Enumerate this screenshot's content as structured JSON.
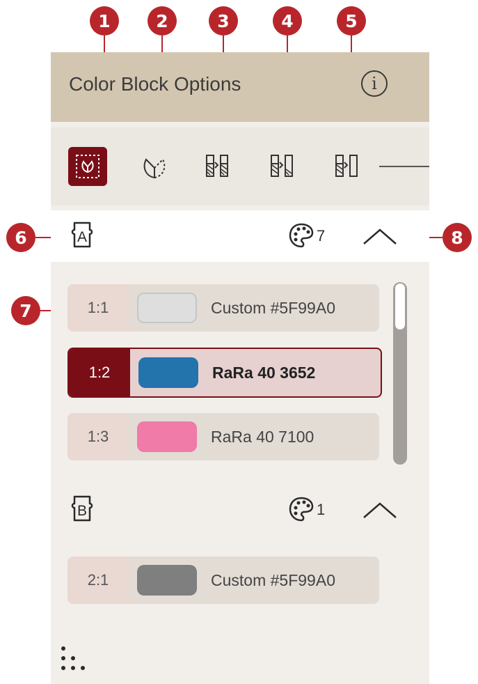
{
  "callouts": [
    "1",
    "2",
    "3",
    "4",
    "5",
    "6",
    "7",
    "8"
  ],
  "header": {
    "title": "Color Block Options",
    "info_icon": "info-icon",
    "info_glyph": "i"
  },
  "toolbar": {
    "buttons": [
      {
        "icon": "embroidery-select-icon",
        "active": true
      },
      {
        "icon": "design-outline-icon",
        "active": false
      },
      {
        "icon": "color-block-merge-icon",
        "active": false
      },
      {
        "icon": "color-block-merge-next-icon",
        "active": false
      },
      {
        "icon": "color-block-split-icon",
        "active": false
      }
    ]
  },
  "groups": [
    {
      "icon": "group-a-icon",
      "letter": "A",
      "palette_icon": "palette-icon",
      "color_count": "7",
      "collapse_icon": "chevron-up-icon",
      "rows": [
        {
          "num": "1:1",
          "label": "Custom #5F99A0",
          "swatch": "#dededf",
          "selected": false
        },
        {
          "num": "1:2",
          "label": "RaRa 40  3652",
          "swatch": "#2373ac",
          "selected": true
        },
        {
          "num": "1:3",
          "label": "RaRa 40  7100",
          "swatch": "#f07aa8",
          "selected": false
        }
      ]
    },
    {
      "icon": "group-b-icon",
      "letter": "B",
      "palette_icon": "palette-icon",
      "color_count": "1",
      "collapse_icon": "chevron-up-icon",
      "rows": [
        {
          "num": "2:1",
          "label": "Custom #5F99A0",
          "swatch": "#7f7f7f",
          "selected": false
        }
      ]
    }
  ],
  "footer": {
    "icon": "dots-grip-icon"
  },
  "colors": {
    "accent": "#7a0e17",
    "callout": "#b8262b",
    "header_bg": "#d3c6b0",
    "panel_bg": "#f2efea"
  }
}
